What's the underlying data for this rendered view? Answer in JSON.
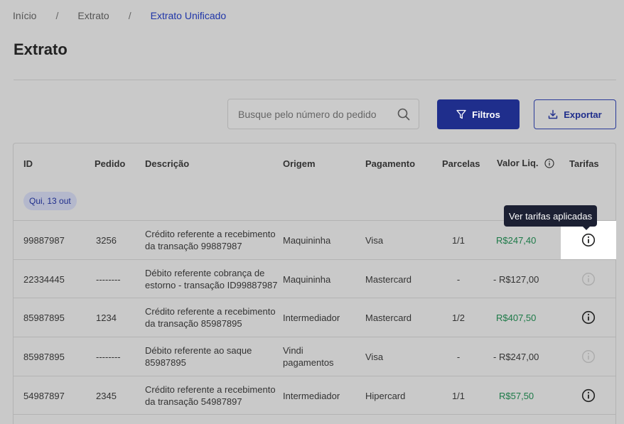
{
  "breadcrumb": {
    "items": [
      "Início",
      "Extrato",
      "Extrato Unificado"
    ],
    "separator": "/"
  },
  "page": {
    "title": "Extrato"
  },
  "search": {
    "placeholder": "Busque pelo número do pedido",
    "value": ""
  },
  "toolbar": {
    "filter_label": "Filtros",
    "export_label": "Exportar"
  },
  "table": {
    "headers": {
      "id": "ID",
      "pedido": "Pedido",
      "descricao": "Descrição",
      "origem": "Origem",
      "pagamento": "Pagamento",
      "parcelas": "Parcelas",
      "valor": "Valor Liq.",
      "tarifas": "Tarifas"
    },
    "date_group": "Qui, 13 out",
    "tooltip": "Ver tarifas aplicadas",
    "rows": [
      {
        "id": "99887987",
        "pedido": "3256",
        "descricao_1": "Crédito referente a recebimento",
        "descricao_2": "da transação 99887987",
        "origem_1": "Maquininha",
        "origem_2": "",
        "pagamento": "Visa",
        "parcelas": "1/1",
        "valor": "R$247,40"
      },
      {
        "id": "22334445",
        "pedido": "--------",
        "descricao_1": "Débito referente cobrança de",
        "descricao_2": "estorno - transação ID99887987",
        "origem_1": "Maquininha",
        "origem_2": "",
        "pagamento": "Mastercard",
        "parcelas": "-",
        "valor": "- R$127,00"
      },
      {
        "id": "85987895",
        "pedido": "1234",
        "descricao_1": "Crédito referente a recebimento",
        "descricao_2": "da transação 85987895",
        "origem_1": "Intermediador",
        "origem_2": "",
        "pagamento": "Mastercard",
        "parcelas": "1/2",
        "valor": "R$407,50"
      },
      {
        "id": "85987895",
        "pedido": "--------",
        "descricao_1": "Débito referente ao saque",
        "descricao_2": "85987895",
        "origem_1": "Vindi",
        "origem_2": "pagamentos",
        "pagamento": "Visa",
        "parcelas": "-",
        "valor": "- R$247,00"
      },
      {
        "id": "54987897",
        "pedido": "2345",
        "descricao_1": "Crédito referente a recebimento",
        "descricao_2": "da transação 54987897",
        "origem_1": "Intermediador",
        "origem_2": "",
        "pagamento": "Hipercard",
        "parcelas": "1/1",
        "valor": "R$57,50"
      }
    ]
  },
  "colors": {
    "primary": "#1f2e8c",
    "link": "#1f35a8",
    "positive": "#1d7a48",
    "icon_active": "#222222",
    "icon_disabled": "#aaaaaa",
    "overlay_bg": "#c9c9c9"
  },
  "icons": {
    "search": "search-icon",
    "filter": "filter-icon",
    "export": "download-icon",
    "info": "info-icon"
  }
}
